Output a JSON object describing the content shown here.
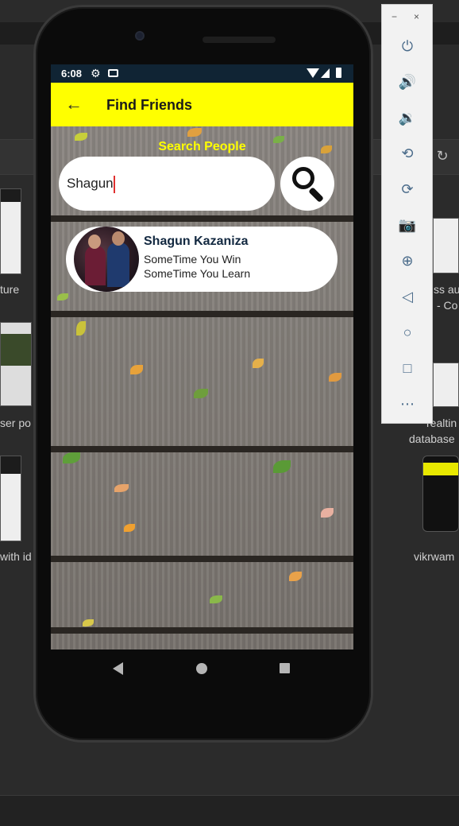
{
  "desktop": {
    "labels": [
      "ture",
      "ser po",
      "with id",
      "ss au",
      "- Co",
      "realtin",
      "database",
      "vikrwam"
    ]
  },
  "status_bar": {
    "time": "6:08",
    "icons": [
      "settings-icon",
      "mail-icon",
      "wifi-icon",
      "signal-icon",
      "battery-icon"
    ]
  },
  "app_bar": {
    "back_icon": "arrow-left-icon",
    "title": "Find Friends",
    "background": "#ffff00"
  },
  "search": {
    "title": "Search People",
    "value": "Shagun",
    "button_icon": "magnifier-icon",
    "title_color": "#ffff00"
  },
  "results": [
    {
      "name": "Shagun Kazaniza",
      "status_line1": "SomeTime You Win",
      "status_line2": "SomeTime You Learn"
    }
  ],
  "emulator_panel": {
    "window_buttons": [
      "−",
      "×"
    ],
    "buttons": [
      "power-icon",
      "volume-up-icon",
      "volume-down-icon",
      "rotate-left-icon",
      "rotate-right-icon",
      "camera-icon",
      "zoom-icon",
      "back-icon",
      "home-icon",
      "overview-icon",
      "more-icon"
    ]
  }
}
